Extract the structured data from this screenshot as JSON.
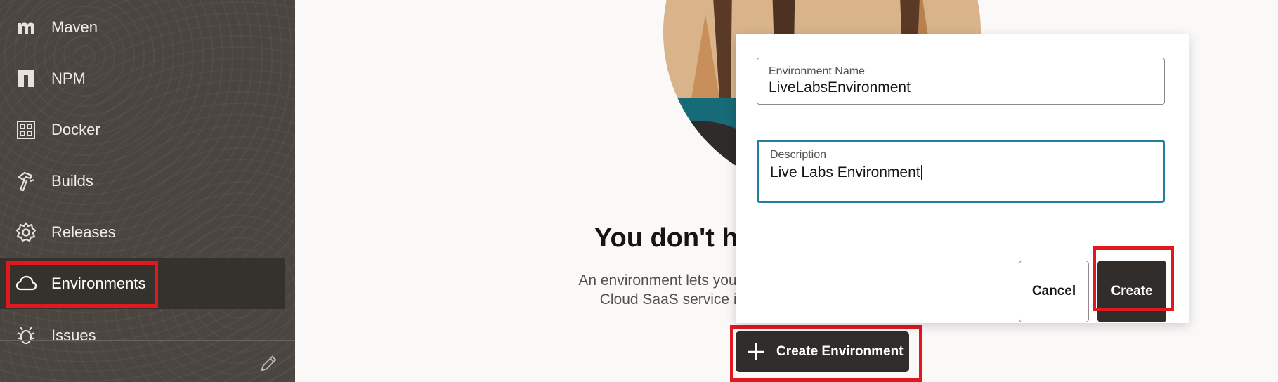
{
  "sidebar": {
    "items": [
      {
        "label": "Maven",
        "icon": "maven-icon"
      },
      {
        "label": "NPM",
        "icon": "npm-icon"
      },
      {
        "label": "Docker",
        "icon": "docker-icon"
      },
      {
        "label": "Builds",
        "icon": "builds-hammer-icon"
      },
      {
        "label": "Releases",
        "icon": "releases-gear-icon"
      },
      {
        "label": "Environments",
        "icon": "cloud-icon",
        "active": true
      },
      {
        "label": "Issues",
        "icon": "bug-icon"
      }
    ],
    "edit_icon": "pencil-icon"
  },
  "empty_state": {
    "title": "You don't ha",
    "description_line1": "An environment lets you conn",
    "description_line2": "Cloud SaaS service instan",
    "create_button": "Create Environment"
  },
  "dialog": {
    "name_label": "Environment Name",
    "name_value": "LiveLabsEnvironment",
    "description_label": "Description",
    "description_value": "Live Labs Environment",
    "cancel_label": "Cancel",
    "create_label": "Create"
  },
  "colors": {
    "sidebar_bg": "#4a4540",
    "active_item_bg": "#35312d",
    "primary_button": "#312d2a",
    "focus_border": "#227e9e",
    "annotation_red": "#e0181f"
  }
}
